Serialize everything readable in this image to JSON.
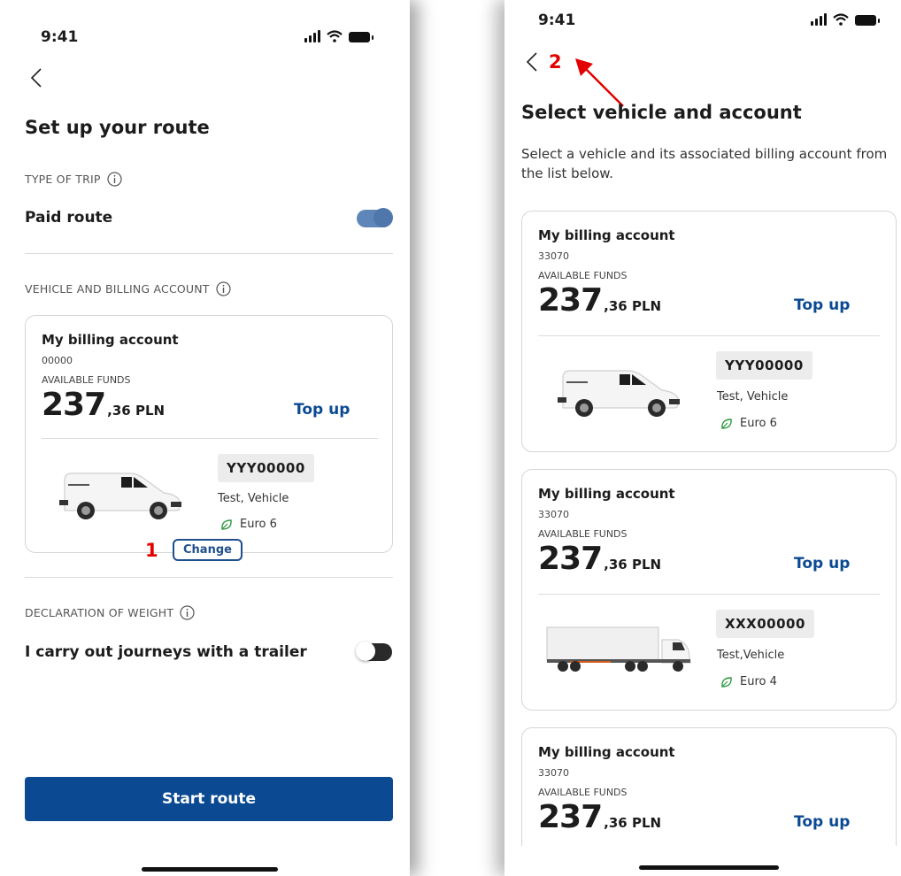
{
  "status_bar": {
    "time": "9:41"
  },
  "screen1": {
    "title": "Set up your route",
    "trip_type": {
      "label": "TYPE OF TRIP",
      "option": "Paid route"
    },
    "vehicle_section": {
      "label": "VEHICLE AND BILLING ACCOUNT"
    },
    "account": {
      "name": "My billing account",
      "number": "00000",
      "funds_label": "AVAILABLE FUNDS",
      "amount_int": "237",
      "amount_dec": ",36 PLN",
      "topup_label": "Top up"
    },
    "vehicle": {
      "plate": "YYY00000",
      "name": "Test, Vehicle",
      "emission": "Euro 6",
      "type": "van"
    },
    "change_label": "Change",
    "annotation": "1",
    "weight_section": {
      "label": "DECLARATION OF WEIGHT",
      "option": "I carry out journeys with a trailer"
    },
    "start_label": "Start route"
  },
  "screen2": {
    "annotation": "2",
    "title": "Select vehicle and account",
    "description": "Select a vehicle and its associated billing account from the list below.",
    "cards": [
      {
        "name": "My billing account",
        "number": "33070",
        "funds_label": "AVAILABLE FUNDS",
        "amount_int": "237",
        "amount_dec": ",36 PLN",
        "topup_label": "Top up",
        "plate": "YYY00000",
        "vehicle_name": "Test, Vehicle",
        "emission": "Euro 6",
        "vehicle_type": "van"
      },
      {
        "name": "My billing account",
        "number": "33070",
        "funds_label": "AVAILABLE FUNDS",
        "amount_int": "237",
        "amount_dec": ",36 PLN",
        "topup_label": "Top up",
        "plate": "XXX00000",
        "vehicle_name": "Test,Vehicle",
        "emission": "Euro 4",
        "vehicle_type": "truck"
      },
      {
        "name": "My billing account",
        "number": "33070",
        "funds_label": "AVAILABLE FUNDS",
        "amount_int": "237",
        "amount_dec": ",36 PLN",
        "topup_label": "Top up"
      }
    ]
  },
  "colors": {
    "primary": "#0b4a93",
    "annotation": "#e30000",
    "leaf": "#2e9a3f",
    "toggle_on": "#5e86b8"
  },
  "icons": [
    "chevron-left-icon",
    "info-icon",
    "leaf-icon",
    "signal-icon",
    "wifi-icon",
    "battery-icon",
    "van-icon",
    "truck-icon",
    "arrow-icon"
  ]
}
